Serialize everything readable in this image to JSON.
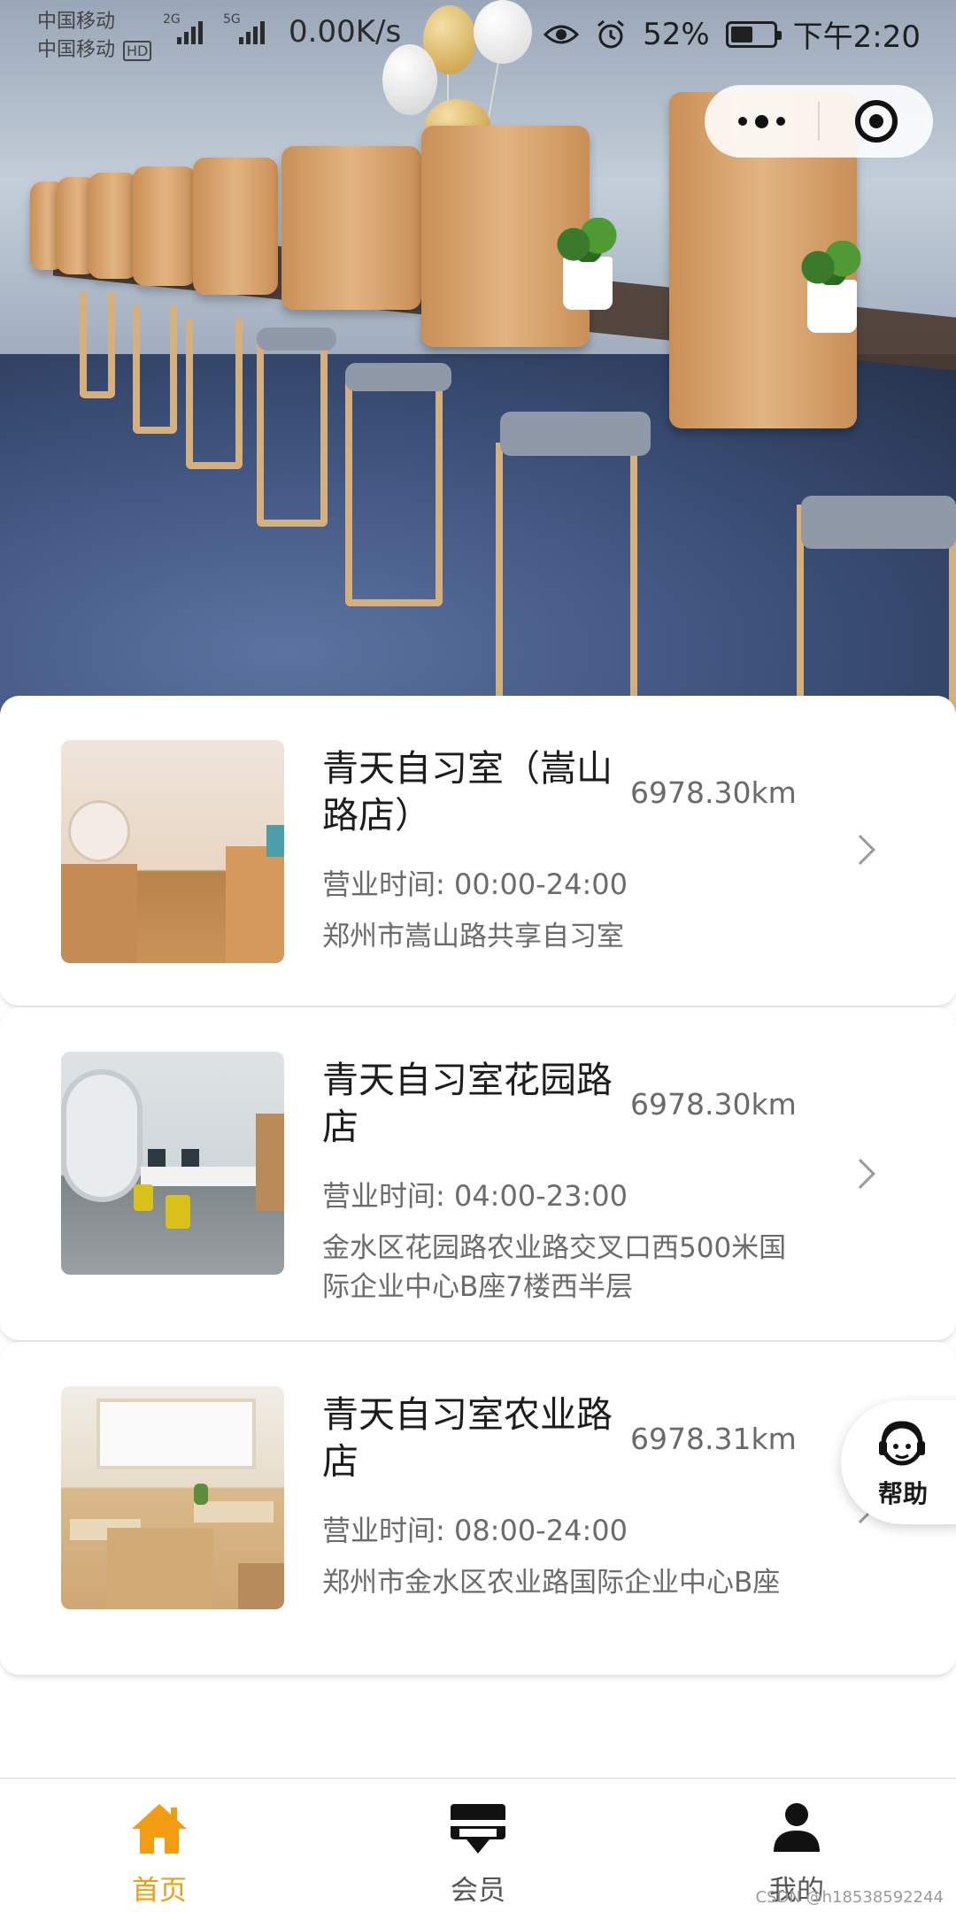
{
  "status_bar": {
    "carrier_1": "中国移动",
    "carrier_2": "中国移动",
    "hd": "HD",
    "net_type_1": "2G",
    "net_type_2": "5G",
    "speed": "0.00K/s",
    "battery_percent": "52%",
    "battery_level": 0.52,
    "time": "下午2:20"
  },
  "capsule": {
    "more_icon": "more-dots-icon",
    "close_icon": "target-close-icon"
  },
  "stores": [
    {
      "name": "青天自习室（嵩山路店）",
      "distance": "6978.30km",
      "hours": "营业时间: 00:00-24:00",
      "address": "郑州市嵩山路共享自习室"
    },
    {
      "name": "青天自习室花园路店",
      "distance": "6978.30km",
      "hours": "营业时间: 04:00-23:00",
      "address": "金水区花园路农业路交叉口西500米国际企业中心B座7楼西半层"
    },
    {
      "name": "青天自习室农业路店",
      "distance": "6978.31km",
      "hours": "营业时间: 08:00-24:00",
      "address": "郑州市金水区农业路国际企业中心B座"
    }
  ],
  "help": {
    "label": "帮助",
    "icon": "headset-icon"
  },
  "tabs": [
    {
      "label": "首页",
      "icon": "home-icon",
      "active": true
    },
    {
      "label": "会员",
      "icon": "member-card-icon",
      "active": false
    },
    {
      "label": "我的",
      "icon": "user-icon",
      "active": false
    }
  ],
  "colors": {
    "accent": "#f29c11",
    "text_primary": "#1c1c1c",
    "text_secondary": "#6b6b6b"
  },
  "watermark": "CSDN @h18538592244"
}
